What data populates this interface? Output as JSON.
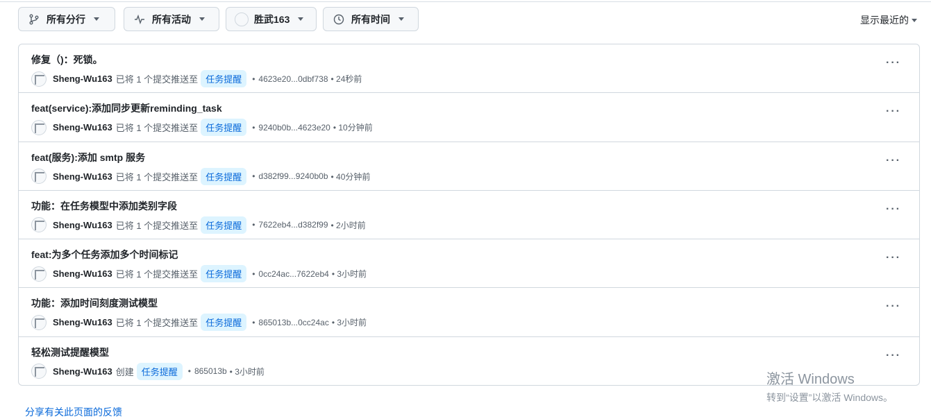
{
  "filters": {
    "branches": "所有分行",
    "activity": "所有活动",
    "user": "胜武163",
    "time": "所有时间",
    "sort": "显示最近的"
  },
  "rows": [
    {
      "title": "修复（)：死锁。",
      "user": "Sheng-Wu163",
      "verb": "已将 1 个提交推送至",
      "branch": "任务提醒",
      "sha": "4623e20...0dbf738",
      "time": "• 24秒前"
    },
    {
      "title": "feat(service):添加同步更新reminding_task",
      "user": "Sheng-Wu163",
      "verb": "已将 1 个提交推送至",
      "branch": "任务提醒",
      "sha": "9240b0b...4623e20",
      "time": "• 10分钟前"
    },
    {
      "title": "feat(服务):添加 smtp 服务",
      "user": "Sheng-Wu163",
      "verb": "已将 1 个提交推送至",
      "branch": "任务提醒",
      "sha": "d382f99...9240b0b",
      "time": "• 40分钟前"
    },
    {
      "title": "功能：在任务模型中添加类别字段",
      "user": "Sheng-Wu163",
      "verb": "已将 1 个提交推送至",
      "branch": "任务提醒",
      "sha": "7622eb4...d382f99",
      "time": "• 2小时前"
    },
    {
      "title": "feat:为多个任务添加多个时间标记",
      "user": "Sheng-Wu163",
      "verb": "已将 1 个提交推送至",
      "branch": "任务提醒",
      "sha": "0cc24ac...7622eb4",
      "time": "• 3小时前"
    },
    {
      "title": "功能：添加时间刻度测试模型",
      "user": "Sheng-Wu163",
      "verb": "已将 1 个提交推送至",
      "branch": "任务提醒",
      "sha": "865013b...0cc24ac",
      "time": "• 3小时前"
    },
    {
      "title": "轻松测试提醒模型",
      "user": "Sheng-Wu163",
      "verb": "创建",
      "branch": "任务提醒",
      "sha": "865013b",
      "time": "• 3小时前"
    }
  ],
  "more_glyph": "···",
  "dot_glyph": "•",
  "feedback_link": "分享有关此页面的反馈",
  "watermark": {
    "line1": "激活 Windows",
    "line2": "转到“设置”以激活 Windows。"
  }
}
